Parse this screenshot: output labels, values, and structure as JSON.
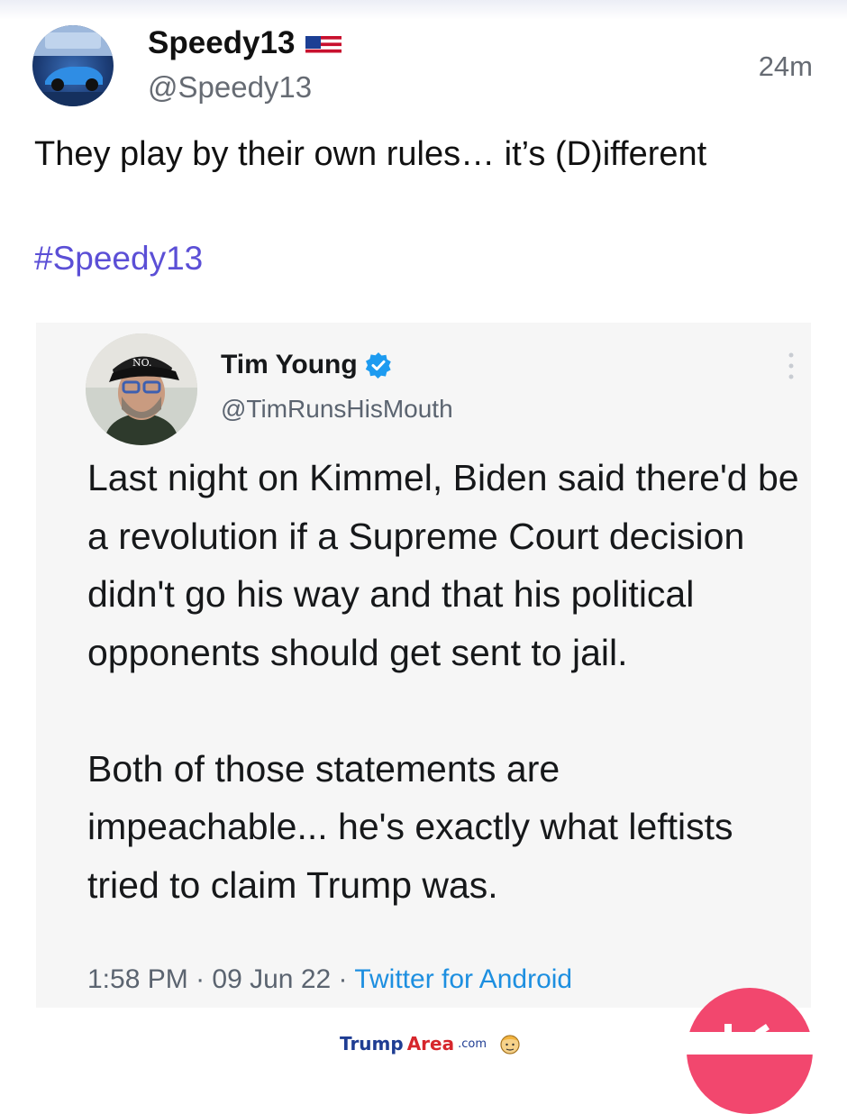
{
  "post": {
    "author": {
      "display_name": "Speedy13",
      "flag_icon": "us-flag-icon",
      "handle": "@Speedy13"
    },
    "timestamp": "24m",
    "text": "They play by their own rules… it’s (D)ifferent",
    "hashtag": "#Speedy13"
  },
  "embedded_tweet": {
    "author_name": "Tim Young",
    "verified_icon": "verified-badge-icon",
    "handle": "@TimRunsHisMouth",
    "hat_text": "NO.",
    "paragraph_1": "Last night on Kimmel, Biden said there'd be a revolution if a Supreme Court decision didn't go his way and that his political opponents should get sent to jail.",
    "paragraph_2": "Both of those statements are impeachable... he's exactly what leftists tried to claim Trump was.",
    "time": "1:58 PM",
    "date": "09 Jun 22",
    "source": "Twitter for Android",
    "separator": "·"
  },
  "watermark": {
    "brand_part_1": "Trump",
    "brand_part_2": "Area",
    "suffix": ".com"
  },
  "colors": {
    "hashtag": "#5b4fd6",
    "fab": "#f2476e",
    "link_blue": "#1d8fe0",
    "muted_text": "#666b73"
  }
}
